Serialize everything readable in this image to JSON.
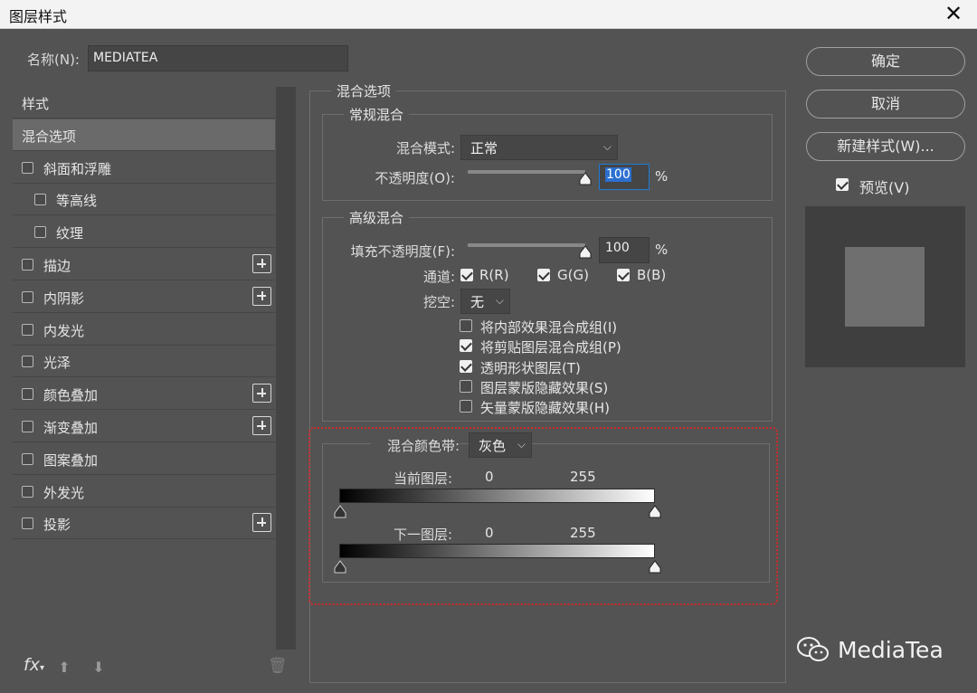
{
  "window": {
    "title": "图层样式",
    "close_glyph": "✕"
  },
  "name_field": {
    "label": "名称(N):",
    "value": "MEDIATEA"
  },
  "styles_list": {
    "items": [
      {
        "label": "样式",
        "type": "header"
      },
      {
        "label": "混合选项",
        "type": "selected"
      },
      {
        "label": "斜面和浮雕",
        "checked": false,
        "plus": false,
        "indent": 0
      },
      {
        "label": "等高线",
        "checked": false,
        "plus": false,
        "indent": 1
      },
      {
        "label": "纹理",
        "checked": false,
        "plus": false,
        "indent": 1
      },
      {
        "label": "描边",
        "checked": false,
        "plus": true,
        "indent": 0
      },
      {
        "label": "内阴影",
        "checked": false,
        "plus": true,
        "indent": 0
      },
      {
        "label": "内发光",
        "checked": false,
        "plus": false,
        "indent": 0
      },
      {
        "label": "光泽",
        "checked": false,
        "plus": false,
        "indent": 0
      },
      {
        "label": "颜色叠加",
        "checked": false,
        "plus": true,
        "indent": 0
      },
      {
        "label": "渐变叠加",
        "checked": false,
        "plus": true,
        "indent": 0
      },
      {
        "label": "图案叠加",
        "checked": false,
        "plus": false,
        "indent": 0
      },
      {
        "label": "外发光",
        "checked": false,
        "plus": false,
        "indent": 0
      },
      {
        "label": "投影",
        "checked": false,
        "plus": true,
        "indent": 0
      }
    ],
    "bottom_fx": "fx"
  },
  "blend_options": {
    "title": "混合选项",
    "general": {
      "title": "常规混合",
      "mode_label": "混合模式:",
      "mode_value": "正常",
      "opacity_label": "不透明度(O):",
      "opacity_value": "100",
      "opacity_percent": "%",
      "opacity_level": 1.0
    },
    "advanced": {
      "title": "高级混合",
      "fill_label": "填充不透明度(F):",
      "fill_value": "100",
      "fill_percent": "%",
      "fill_level": 1.0,
      "channels_label": "通道:",
      "channel_r": "R(R)",
      "channel_g": "G(G)",
      "channel_b": "B(B)",
      "knockout_label": "挖空:",
      "knockout_value": "无",
      "options": [
        {
          "label": "将内部效果混合成组(I)",
          "checked": false
        },
        {
          "label": "将剪贴图层混合成组(P)",
          "checked": true
        },
        {
          "label": "透明形状图层(T)",
          "checked": true
        },
        {
          "label": "图层蒙版隐藏效果(S)",
          "checked": false
        },
        {
          "label": "矢量蒙版隐藏效果(H)",
          "checked": false
        }
      ]
    },
    "blend_if": {
      "label": "混合颜色带:",
      "value": "灰色",
      "this_layer_label": "当前图层:",
      "this_layer_min": "0",
      "this_layer_max": "255",
      "underlying_label": "下一图层:",
      "underlying_min": "0",
      "underlying_max": "255"
    }
  },
  "buttons": {
    "ok": "确定",
    "cancel": "取消",
    "new_style": "新建样式(W)...",
    "preview_label": "预览(V)",
    "preview_checked": true
  },
  "watermark": "MediaTea",
  "colors": {
    "accent": "#1e7bd3",
    "highlight_border": "#d22a2a",
    "panel_bg": "#535353"
  }
}
